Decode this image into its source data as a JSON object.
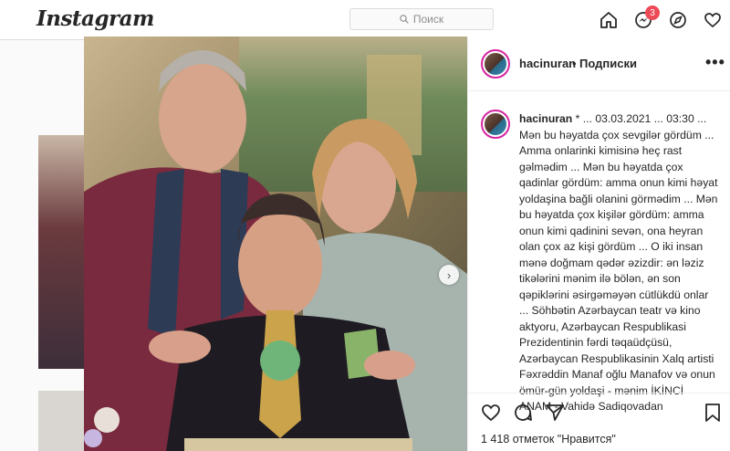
{
  "topbar": {
    "logo": "Instagram",
    "search_placeholder": "Поиск",
    "notifications_count": "3"
  },
  "post": {
    "username": "hacinuran",
    "separator": "•",
    "follow_label": "Подписки",
    "more_label": "•••",
    "caption_user": "hacinuran",
    "caption_text": "* ... 03.03.2021 ... 03:30 ... Mən bu həyatda çox sevgilər gördüm ... Amma onlarinki kimisinə heç rast gəlmədim ... Mən bu həyatda çox qadinlar gördüm: amma onun kimi həyat yoldaşina bağli olanini görmədim ... Mən bu həyatda çox kişilər gördüm: amma onun kimi qadinini sevən, ona heyran olan çox az kişi gördüm ... O iki insan mənə doğmam qədər əzizdir: ən ləziz tikələrini mənim ilə bölən, ən son qəpiklərini əsirgəməyən cütlükdü onlar ... Söhbətin Azərbaycan teatr və kino aktyoru, Azərbaycan Respublikasi Prezidentinin fərdi təqaüdçüsü, Azərbaycan Respublikasinin Xalq artisti Fəxrəddin Manaf oğlu Manafov və onun ömür-gün yoldaşi - mənim İKİNCİ ANAM - Vahidə Sadiqovadan",
    "likes_text": "1 418 отметок \"Нравится\""
  }
}
